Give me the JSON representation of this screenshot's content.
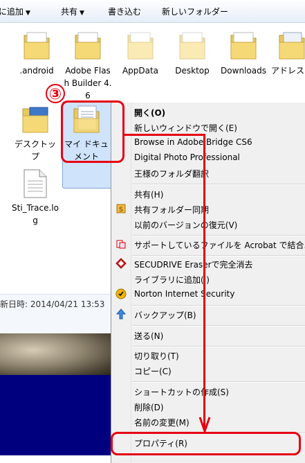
{
  "toolbar": {
    "add_to_library": "に追加",
    "share": "共有",
    "burn": "書き込む",
    "new_folder": "新しいフォルダー"
  },
  "files": [
    {
      "name": ".android",
      "type": "folder"
    },
    {
      "name": "Adobe Flash Builder 4.6",
      "type": "folder"
    },
    {
      "name": "AppData",
      "type": "folder-faded"
    },
    {
      "name": "Desktop",
      "type": "folder-faded"
    },
    {
      "name": "Downloads",
      "type": "folder"
    },
    {
      "name": "アドレス",
      "type": "folder"
    },
    {
      "name": "デスクトップ",
      "type": "folder-desktop"
    },
    {
      "name": "マイ ドキュメント",
      "type": "folder-docs"
    },
    {
      "name": "Sti_Trace.log",
      "type": "file"
    }
  ],
  "details": {
    "date_text": "新日時: 2014/04/21 13:53"
  },
  "annotation": {
    "step_number": "③"
  },
  "menu": {
    "open": "開く(O)",
    "open_new_window": "新しいウィンドウで開く(E)",
    "browse_bridge": "Browse in Adobe Bridge CS6",
    "digital_photo": "Digital Photo Professional",
    "folder_translate": "王様のフォルダ翻訳",
    "share": "共有(H)",
    "shared_folder_sync": "共有フォルダー同期",
    "restore_previous": "以前のバージョンの復元(V)",
    "acrobat_combine": "サポートしているファイルを Acrobat で結合...",
    "secudrive": "SECUDRIVE Eraserで完全消去",
    "add_library": "ライブラリに追加(I)",
    "norton": "Norton Internet Security",
    "backup": "バックアップ(B)",
    "send_to": "送る(N)",
    "cut": "切り取り(T)",
    "copy": "コピー(C)",
    "create_shortcut": "ショートカットの作成(S)",
    "delete": "削除(D)",
    "rename": "名前の変更(M)",
    "properties": "プロパティ(R)"
  },
  "colors": {
    "annotation_red": "#e60012",
    "selection_blue": "#cfe3fb",
    "desktop_blue": "#00007f"
  }
}
